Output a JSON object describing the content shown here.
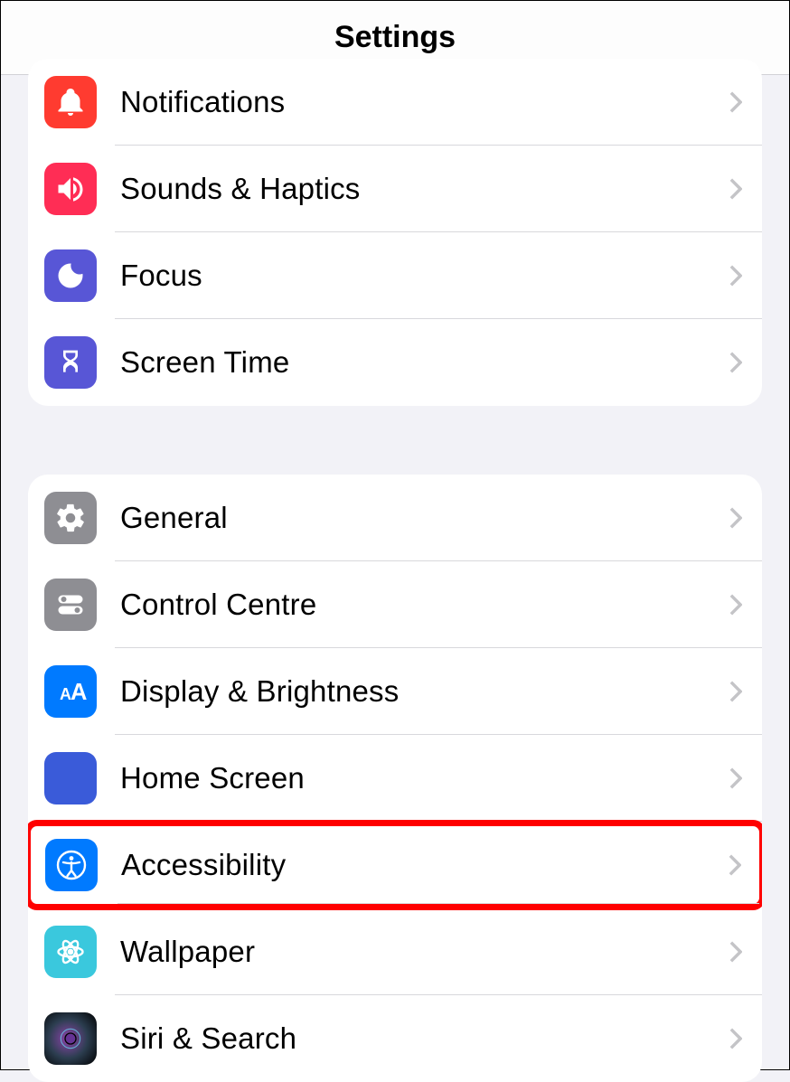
{
  "header": {
    "title": "Settings"
  },
  "groups": [
    {
      "items": [
        {
          "id": "notifications",
          "label": "Notifications",
          "icon": "bell-icon",
          "color": "#ff3b30"
        },
        {
          "id": "sounds-haptics",
          "label": "Sounds & Haptics",
          "icon": "speaker-icon",
          "color": "#ff2d55"
        },
        {
          "id": "focus",
          "label": "Focus",
          "icon": "moon-icon",
          "color": "#5856d6"
        },
        {
          "id": "screen-time",
          "label": "Screen Time",
          "icon": "hourglass-icon",
          "color": "#5856d6"
        }
      ]
    },
    {
      "items": [
        {
          "id": "general",
          "label": "General",
          "icon": "gear-icon",
          "color": "#8e8e93"
        },
        {
          "id": "control-centre",
          "label": "Control Centre",
          "icon": "toggles-icon",
          "color": "#8e8e93"
        },
        {
          "id": "display-brightness",
          "label": "Display & Brightness",
          "icon": "text-size-icon",
          "color": "#007aff"
        },
        {
          "id": "home-screen",
          "label": "Home Screen",
          "icon": "grid-icon",
          "color": "#3a5bd9"
        },
        {
          "id": "accessibility",
          "label": "Accessibility",
          "icon": "accessibility-icon",
          "color": "#007aff",
          "highlighted": true
        },
        {
          "id": "wallpaper",
          "label": "Wallpaper",
          "icon": "flower-icon",
          "color": "#3ac8dd"
        },
        {
          "id": "siri-search",
          "label": "Siri & Search",
          "icon": "siri-icon",
          "color": "#000000"
        }
      ]
    }
  ]
}
